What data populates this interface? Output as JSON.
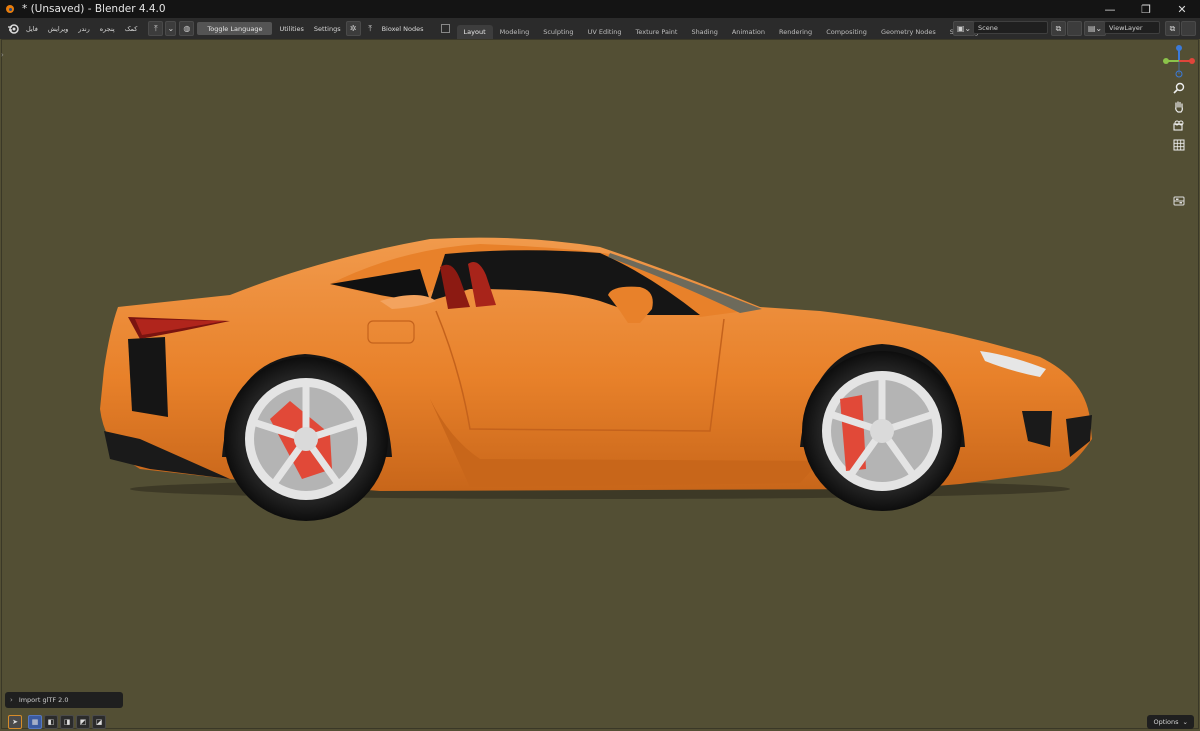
{
  "window": {
    "title": "* (Unsaved) - Blender 4.4.0",
    "controls": {
      "minimize": "—",
      "restore": "❐",
      "close": "✕"
    }
  },
  "menu": {
    "rtl_items": [
      "فایل",
      "ویرایش",
      "رندر",
      "پنجره",
      "کمک"
    ],
    "toggle_language": "Toggle Language",
    "utilities": "Utilities",
    "settings": "Settings",
    "bioxel_nodes": "Bioxel Nodes"
  },
  "workspaces": {
    "tabs": [
      "Layout",
      "Modeling",
      "Sculpting",
      "UV Editing",
      "Texture Paint",
      "Shading",
      "Animation",
      "Rendering",
      "Compositing",
      "Geometry Nodes",
      "Scripting"
    ],
    "active": "Layout",
    "add": "+"
  },
  "scene": {
    "name": "Scene"
  },
  "view_layer": {
    "name": "ViewLayer"
  },
  "viewport": {
    "background_color": "#534f34",
    "last_operator": "Import glTF 2.0",
    "options_label": "Options",
    "model": "orange sports car (side view)",
    "car_color": "#e8812a",
    "wheel_color": "#e4e4e4",
    "brake_color": "#e53d2a"
  },
  "nav_tools": [
    "zoom-icon",
    "hand-pan-icon",
    "camera-icon",
    "grid-icon"
  ]
}
